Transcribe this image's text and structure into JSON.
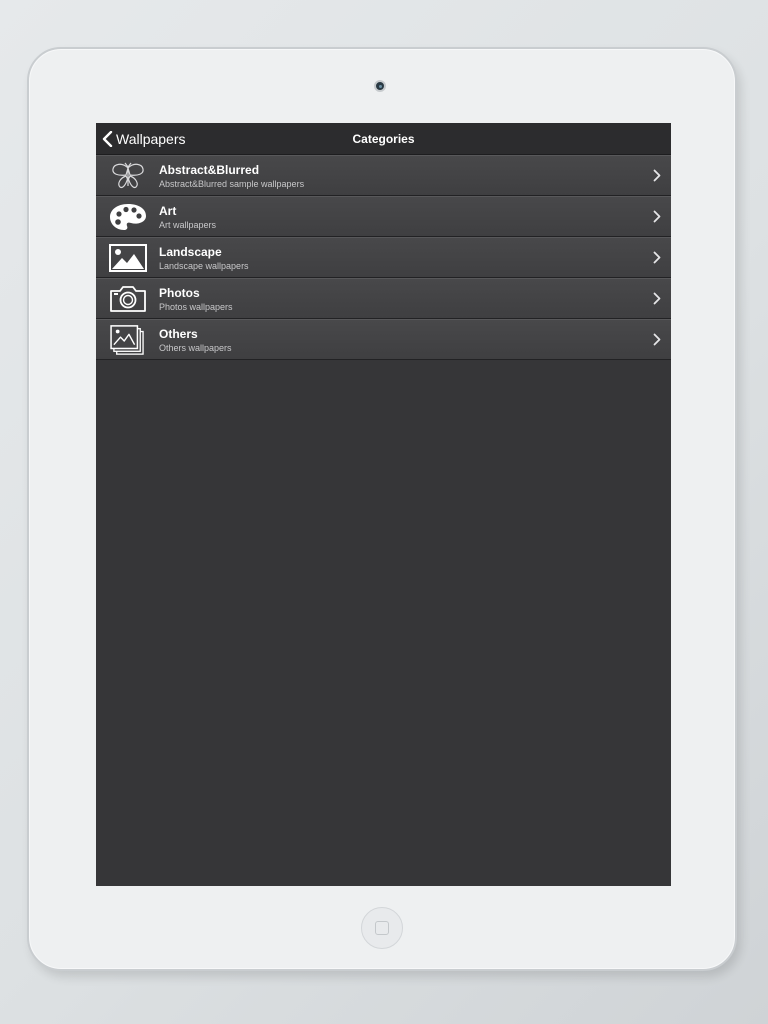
{
  "navbar": {
    "back_label": "Wallpapers",
    "title": "Categories"
  },
  "categories": [
    {
      "title": "Abstract&Blurred",
      "subtitle": "Abstract&Blurred sample wallpapers",
      "icon": "butterfly-icon"
    },
    {
      "title": "Art",
      "subtitle": "Art wallpapers",
      "icon": "palette-icon"
    },
    {
      "title": "Landscape",
      "subtitle": "Landscape wallpapers",
      "icon": "landscape-icon"
    },
    {
      "title": "Photos",
      "subtitle": "Photos wallpapers",
      "icon": "camera-icon"
    },
    {
      "title": "Others",
      "subtitle": "Others wallpapers",
      "icon": "photo-stack-icon"
    }
  ],
  "colors": {
    "screen_bg": "#363638",
    "navbar_bg": "#2c2c2e",
    "row_bg": "#444446",
    "text_primary": "#ffffff",
    "text_secondary": "#c8c8ca"
  }
}
